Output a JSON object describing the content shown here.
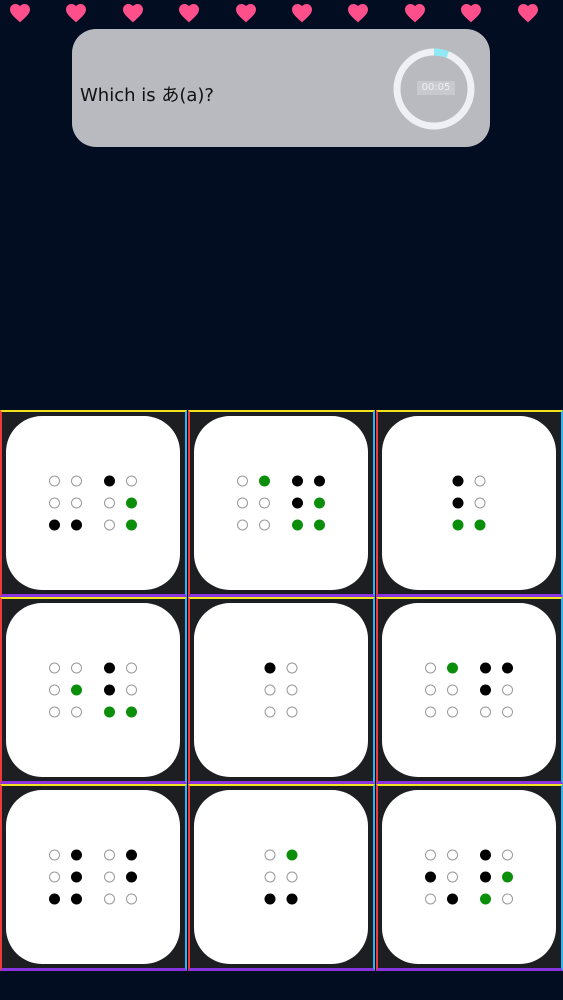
{
  "game": {
    "lives": 10,
    "question": "Which is あ(a)?",
    "timer": {
      "label": "00:05",
      "progress": 0.06
    },
    "colors": {
      "heart": "#ff4f8b",
      "cell_top": "#f0e21d",
      "cell_left": "#ef3b3b",
      "cell_right": "#2cb4f5",
      "cell_bottom": "#8a33e0",
      "dot_raised": "#000000",
      "dot_highlight": "#0b8f0b",
      "dot_empty": "#999999",
      "timer_arc": "#8ee9f4"
    },
    "options": [
      {
        "cells": [
          [
            "",
            "",
            "raised",
            "",
            "",
            "raised"
          ],
          [
            "raised",
            "",
            "",
            "",
            "highlight",
            "highlight"
          ]
        ]
      },
      {
        "cells": [
          [
            "",
            "",
            "",
            "highlight",
            "",
            ""
          ],
          [
            "raised",
            "raised",
            "highlight",
            "raised",
            "highlight",
            "highlight"
          ]
        ]
      },
      {
        "cells": [
          [
            "raised",
            "raised",
            "highlight",
            "",
            "",
            "highlight"
          ]
        ]
      },
      {
        "cells": [
          [
            "",
            "",
            "",
            "",
            "highlight",
            ""
          ],
          [
            "raised",
            "raised",
            "highlight",
            "",
            "",
            "highlight"
          ]
        ]
      },
      {
        "cells": [
          [
            "raised",
            "",
            "",
            "",
            "",
            ""
          ]
        ]
      },
      {
        "cells": [
          [
            "",
            "",
            "",
            "highlight",
            "",
            ""
          ],
          [
            "raised",
            "raised",
            "",
            "raised",
            "",
            ""
          ]
        ]
      },
      {
        "cells": [
          [
            "",
            "",
            "raised",
            "raised",
            "raised",
            "raised"
          ],
          [
            "",
            "",
            "",
            "raised",
            "raised",
            ""
          ]
        ]
      },
      {
        "cells": [
          [
            "",
            "",
            "raised",
            "highlight",
            "",
            "raised"
          ]
        ]
      },
      {
        "cells": [
          [
            "",
            "raised",
            "",
            "",
            "",
            "raised"
          ],
          [
            "raised",
            "raised",
            "highlight",
            "",
            "highlight",
            ""
          ]
        ]
      }
    ]
  }
}
